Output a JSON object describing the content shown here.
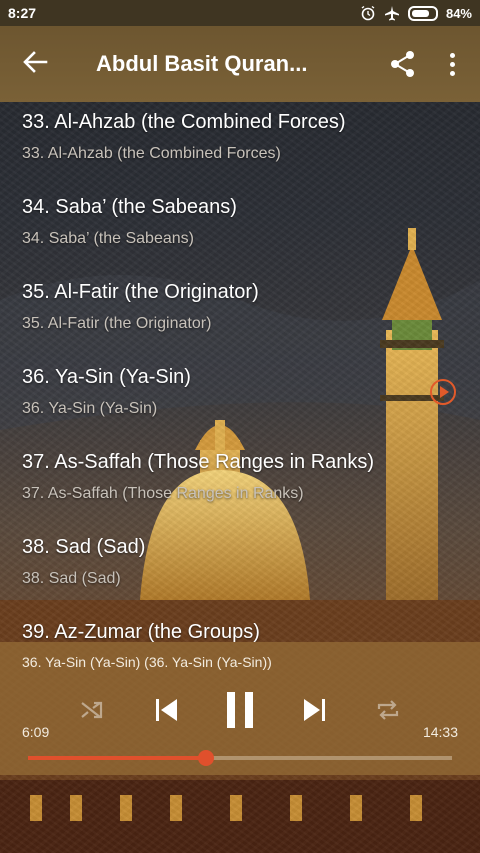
{
  "status_bar": {
    "time": "8:27",
    "battery": "84%",
    "icons": [
      "alarm-icon",
      "airplane-icon",
      "battery-icon"
    ]
  },
  "app_bar": {
    "title": "Abdul Basit Quran...",
    "icons": [
      "back-arrow-icon",
      "share-icon",
      "more-vert-icon"
    ]
  },
  "list": {
    "items": [
      {
        "title": "33. Al-Ahzab (the Combined Forces)",
        "subtitle": "33. Al-Ahzab (the Combined Forces)",
        "playing": false
      },
      {
        "title": "34. Saba’ (the Sabeans)",
        "subtitle": "34. Saba’ (the Sabeans)",
        "playing": false
      },
      {
        "title": "35. Al-Fatir (the Originator)",
        "subtitle": "35. Al-Fatir (the Originator)",
        "playing": false
      },
      {
        "title": "36. Ya-Sin (Ya-Sin)",
        "subtitle": "36. Ya-Sin (Ya-Sin)",
        "playing": true
      },
      {
        "title": "37. As-Saffah (Those Ranges in Ranks)",
        "subtitle": "37. As-Saffah (Those Ranges in Ranks)",
        "playing": false
      },
      {
        "title": "38. Sad (Sad)",
        "subtitle": "38. Sad (Sad)",
        "playing": false
      }
    ],
    "partial_item": "39. Az-Zumar (the Groups)"
  },
  "player": {
    "now_playing": "36. Ya-Sin (Ya-Sin) (36. Ya-Sin (Ya-Sin))",
    "current_time": "6:09",
    "total_time": "14:33",
    "progress_fraction": 0.42,
    "accent_color": "#e0502c",
    "controls": [
      "shuffle-icon",
      "previous-icon",
      "pause-icon",
      "next-icon",
      "repeat-icon"
    ]
  }
}
